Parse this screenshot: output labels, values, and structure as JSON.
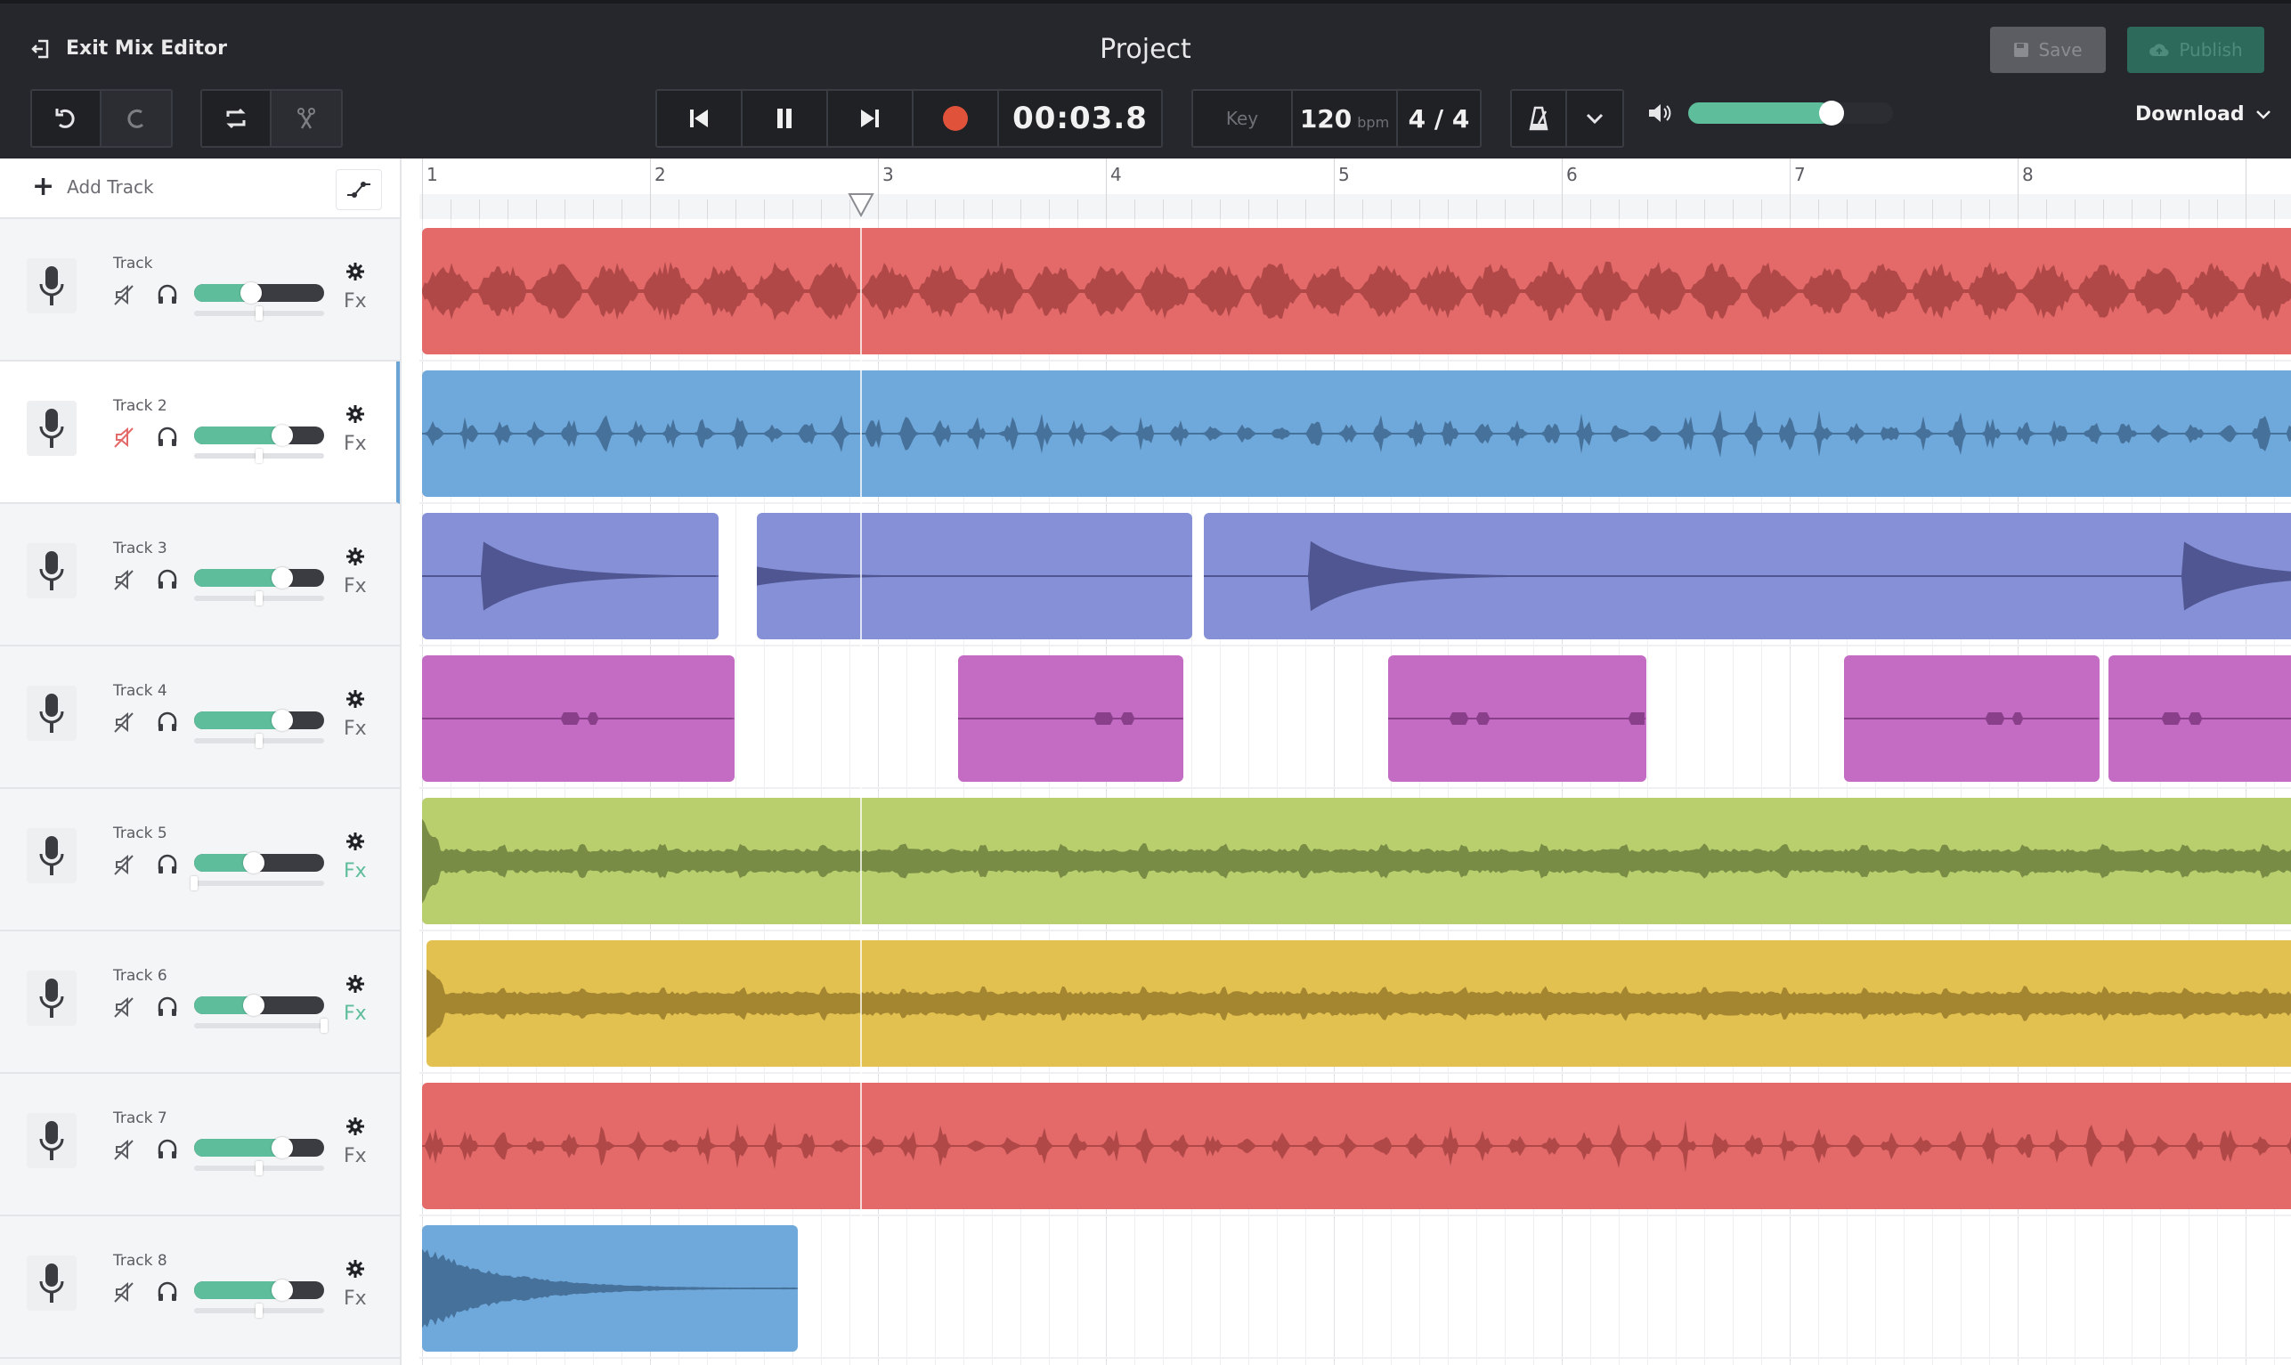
{
  "header": {
    "exit_label": "Exit Mix Editor",
    "title": "Project",
    "save_label": "Save",
    "publish_label": "Publish",
    "download_label": "Download",
    "time_display": "00:03.8",
    "key_label": "Key",
    "tempo_value": "120",
    "tempo_unit": "bpm",
    "time_signature": "4 / 4",
    "master_volume": 0.7
  },
  "colors": {
    "accent": "#5ebd9b",
    "record": "#e0523a",
    "header_bg": "#25272d"
  },
  "sidebar": {
    "add_track_label": "Add Track"
  },
  "ruler": {
    "bars": [
      "1",
      "2",
      "3",
      "4",
      "5",
      "6",
      "7",
      "8"
    ],
    "playhead_bar": 2.92
  },
  "tracks": [
    {
      "name": "Track",
      "muted": false,
      "volume": 0.44,
      "pan": 0.0,
      "fx_active": false,
      "selected": false,
      "color": "#e46a6a",
      "wave": "#b14848",
      "style": "vocal",
      "clips": [
        {
          "start": 1.0,
          "end": 9.3
        }
      ]
    },
    {
      "name": "Track 2",
      "muted": true,
      "volume": 0.68,
      "pan": 0.0,
      "fx_active": false,
      "selected": true,
      "color": "#6fa8da",
      "wave": "#46719b",
      "style": "sparse",
      "clips": [
        {
          "start": 1.0,
          "end": 9.3
        }
      ]
    },
    {
      "name": "Track 3",
      "muted": false,
      "volume": 0.68,
      "pan": 0.0,
      "fx_active": false,
      "selected": false,
      "color": "#8590d6",
      "wave": "#4f5692",
      "style": "pluck",
      "clips": [
        {
          "start": 1.0,
          "end": 2.3
        },
        {
          "start": 2.47,
          "end": 4.38
        },
        {
          "start": 4.43,
          "end": 9.3
        }
      ]
    },
    {
      "name": "Track 4",
      "muted": false,
      "volume": 0.68,
      "pan": 0.0,
      "fx_active": false,
      "selected": false,
      "color": "#c46cc4",
      "wave": "#8a3f8a",
      "style": "blips",
      "clips": [
        {
          "start": 1.0,
          "end": 2.37
        },
        {
          "start": 3.35,
          "end": 4.34
        },
        {
          "start": 5.24,
          "end": 6.37
        },
        {
          "start": 7.24,
          "end": 8.36
        },
        {
          "start": 8.4,
          "end": 9.3
        }
      ]
    },
    {
      "name": "Track 5",
      "muted": false,
      "volume": 0.46,
      "pan": -1.0,
      "fx_active": true,
      "selected": false,
      "color": "#b9cf6e",
      "wave": "#788c45",
      "style": "pad",
      "clips": [
        {
          "start": 1.0,
          "end": 9.3
        }
      ]
    },
    {
      "name": "Track 6",
      "muted": false,
      "volume": 0.46,
      "pan": 1.0,
      "fx_active": true,
      "selected": false,
      "color": "#e2c150",
      "wave": "#a48530",
      "style": "pad",
      "clips": [
        {
          "start": 1.02,
          "end": 9.3
        }
      ]
    },
    {
      "name": "Track 7",
      "muted": false,
      "volume": 0.68,
      "pan": 0.0,
      "fx_active": false,
      "selected": false,
      "color": "#e46a6a",
      "wave": "#b14848",
      "style": "sparse",
      "clips": [
        {
          "start": 1.0,
          "end": 9.3
        }
      ]
    },
    {
      "name": "Track 8",
      "muted": false,
      "volume": 0.68,
      "pan": 0.0,
      "fx_active": false,
      "selected": false,
      "color": "#6fa8da",
      "wave": "#46719b",
      "style": "decay",
      "clips": [
        {
          "start": 1.0,
          "end": 2.65
        }
      ]
    }
  ]
}
